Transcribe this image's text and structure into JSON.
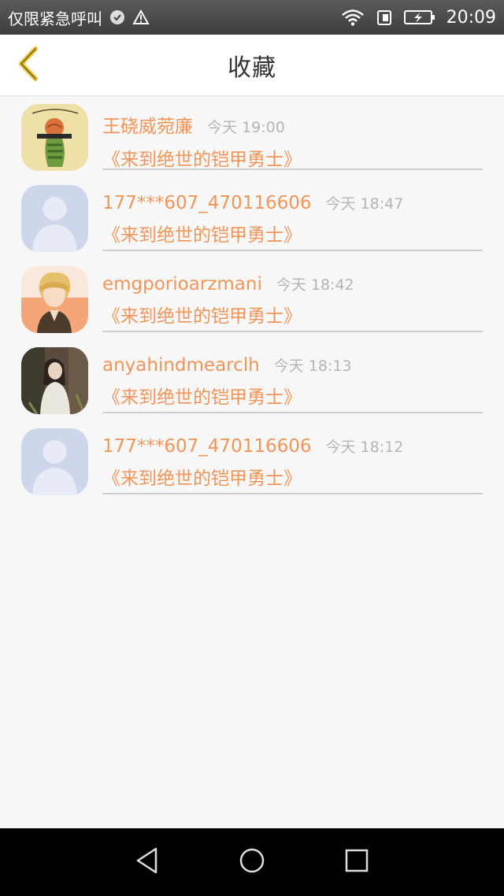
{
  "status_bar": {
    "carrier": "仅限紧急呼叫",
    "time": "20:09",
    "icons": [
      "shield-check-icon",
      "warning-icon",
      "wifi-icon",
      "sim-icon",
      "battery-charging-icon"
    ]
  },
  "header": {
    "title": "收藏",
    "back_icon": "chevron-left-icon"
  },
  "favorites": [
    {
      "user": "王硗威菀廉",
      "time": "今天 19:00",
      "book": "《来到绝世的铠甲勇士》",
      "avatar": "avatar-sagittarius"
    },
    {
      "user": "177***607_470116606",
      "time": "今天 18:47",
      "book": "《来到绝世的铠甲勇士》",
      "avatar": "avatar-default"
    },
    {
      "user": "emgporioarzmani",
      "time": "今天 18:42",
      "book": "《来到绝世的铠甲勇士》",
      "avatar": "avatar-anime"
    },
    {
      "user": "anyahindmearclh",
      "time": "今天 18:13",
      "book": "《来到绝世的铠甲勇士》",
      "avatar": "avatar-photo"
    },
    {
      "user": "177***607_470116606",
      "time": "今天 18:12",
      "book": "《来到绝世的铠甲勇士》",
      "avatar": "avatar-default"
    }
  ],
  "nav_bar": {
    "icons": [
      "back-triangle-icon",
      "home-circle-icon",
      "recents-square-icon"
    ]
  },
  "colors": {
    "accent": "#f0955a",
    "back_arrow": "#e9c23a"
  }
}
